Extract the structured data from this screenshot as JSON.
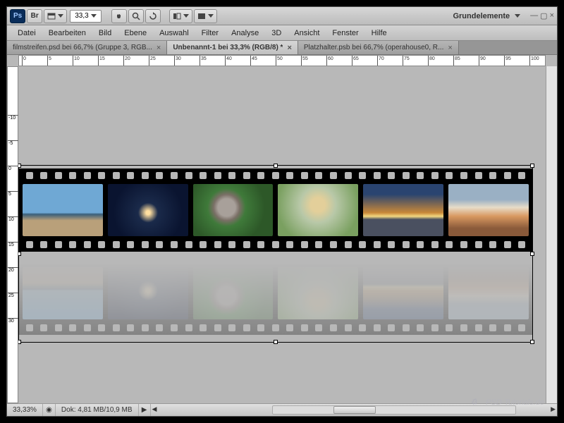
{
  "toolbar": {
    "zoom": "33,3",
    "workspace": "Grundelemente"
  },
  "menu": [
    "Datei",
    "Bearbeiten",
    "Bild",
    "Ebene",
    "Auswahl",
    "Filter",
    "Analyse",
    "3D",
    "Ansicht",
    "Fenster",
    "Hilfe"
  ],
  "tabs": [
    {
      "label": "filmstreifen.psd bei 66,7% (Gruppe 3, RGB...",
      "active": false
    },
    {
      "label": "Unbenannt-1 bei 33,3% (RGB/8) *",
      "active": true
    },
    {
      "label": "Platzhalter.psb bei 66,7% (operahouse0, R...",
      "active": false
    }
  ],
  "ruler_h": [
    0,
    5,
    10,
    15,
    20,
    25,
    30,
    35,
    40,
    45,
    50,
    55,
    60,
    65,
    70,
    75,
    80,
    85,
    90,
    95,
    100
  ],
  "ruler_v": [
    0,
    5,
    10,
    15,
    20,
    25,
    30
  ],
  "status": {
    "zoom": "33,33%",
    "doc": "Dok: 4,81 MB/10,9 MB"
  },
  "watermark": "PSD-Tutorials.de"
}
